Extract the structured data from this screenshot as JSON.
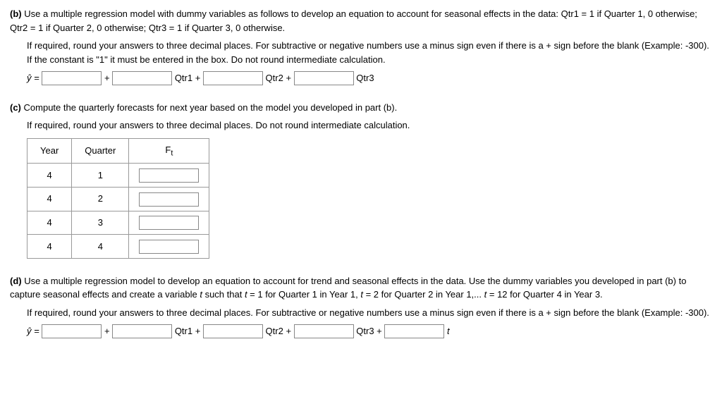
{
  "partB": {
    "label": "(b)",
    "text1": "Use a multiple regression model with dummy variables as follows to develop an equation to account for seasonal effects in the data: Qtr1 = 1 if Quarter 1, 0 otherwise; Qtr2 = 1 if Quarter 2, 0 otherwise; Qtr3 = 1 if Quarter 3, 0 otherwise.",
    "text2": "If required, round your answers to three decimal places. For subtractive or negative numbers use a minus sign even if there is a + sign before the blank (Example: -300). If the constant is \"1\" it must be entered in the box. Do not round intermediate calculation.",
    "eq_lhs": "ŷ =",
    "plus": " + ",
    "qtr1": " Qtr1 + ",
    "qtr2": " Qtr2 + ",
    "qtr3": " Qtr3"
  },
  "partC": {
    "label": "(c)",
    "text1": "Compute the quarterly forecasts for next year based on the model you developed in part (b).",
    "text2": "If required, round your answers to three decimal places. Do not round intermediate calculation.",
    "headers": {
      "year": "Year",
      "quarter": "Quarter",
      "ft": "Ft"
    },
    "rows": [
      {
        "year": "4",
        "quarter": "1"
      },
      {
        "year": "4",
        "quarter": "2"
      },
      {
        "year": "4",
        "quarter": "3"
      },
      {
        "year": "4",
        "quarter": "4"
      }
    ]
  },
  "partD": {
    "label": "(d)",
    "text1_a": "Use a multiple regression model to develop an equation to account for trend and seasonal effects in the data. Use the dummy variables you developed in part (b) to capture seasonal effects and create a variable ",
    "t": "t",
    "text1_b": " such that ",
    "text1_c": " = 1 for Quarter 1 in Year 1, ",
    "text1_d": " = 2 for Quarter 2 in Year 1,... ",
    "text1_e": " = 12 for Quarter 4 in Year 3.",
    "text2": "If required, round your answers to three decimal places. For subtractive or negative numbers use a minus sign even if there is a + sign before the blank (Example: -300).",
    "eq_lhs": "ŷ =",
    "plus": " + ",
    "qtr1": " Qtr1 + ",
    "qtr2": " Qtr2 + ",
    "qtr3": " Qtr3 + ",
    "tvar": " t"
  }
}
